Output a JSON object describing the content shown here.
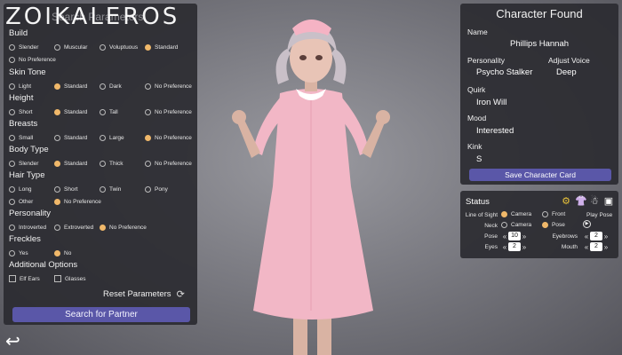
{
  "logo": {
    "text": "ZOIKALEROS"
  },
  "search": {
    "title": "Search Parameters",
    "sections": [
      {
        "label": "Build",
        "options": [
          "Slender",
          "Muscular",
          "Voluptuous",
          "Standard",
          "No Preference"
        ],
        "selected": 3
      },
      {
        "label": "Skin Tone",
        "options": [
          "Light",
          "Standard",
          "Dark",
          "No Preference"
        ],
        "selected": 1
      },
      {
        "label": "Height",
        "options": [
          "Short",
          "Standard",
          "Tall",
          "No Preference"
        ],
        "selected": 1
      },
      {
        "label": "Breasts",
        "options": [
          "Small",
          "Standard",
          "Large",
          "No Preference"
        ],
        "selected": 3
      },
      {
        "label": "Body Type",
        "options": [
          "Slender",
          "Standard",
          "Thick",
          "No Preference"
        ],
        "selected": 1
      },
      {
        "label": "Hair Type",
        "options": [
          "Long",
          "Short",
          "Twin",
          "Pony",
          "Other",
          "No Preference"
        ],
        "selected": 5
      },
      {
        "label": "Personality",
        "options": [
          "Introverted",
          "Extroverted",
          "No Preference"
        ],
        "selected": 2
      },
      {
        "label": "Freckles",
        "options": [
          "Yes",
          "No"
        ],
        "selected": 1
      }
    ],
    "additional": {
      "label": "Additional Options",
      "options": [
        "Elf Ears",
        "Glasses"
      ]
    },
    "reset_label": "Reset Parameters",
    "search_button": "Search for Partner"
  },
  "character": {
    "title": "Character Found",
    "name_label": "Name",
    "name": "Phillips Hannah",
    "personality_label": "Personality",
    "personality": "Psycho Stalker",
    "voice_label": "Adjust Voice",
    "voice": "Deep",
    "quirk_label": "Quirk",
    "quirk": "Iron Will",
    "mood_label": "Mood",
    "mood": "Interested",
    "kink_label": "Kink",
    "kink": "S",
    "save_button": "Save Character Card"
  },
  "status": {
    "title": "Status",
    "line_of_sight_label": "Line of Sight",
    "los_camera": "Camera",
    "los_front": "Front",
    "play_pose_label": "Play Pose",
    "neck_label": "Neck",
    "neck_camera": "Camera",
    "neck_pose": "Pose",
    "pose_label": "Pose",
    "pose_value": "10",
    "eyebrows_label": "Eyebrows",
    "eyebrows_value": "2",
    "eyes_label": "Eyes",
    "eyes_value": "2",
    "mouth_label": "Mouth",
    "mouth_value": "2"
  },
  "colors": {
    "accent": "#5a57a8",
    "selected": "#f0b86a",
    "panel": "#2b2b31"
  }
}
